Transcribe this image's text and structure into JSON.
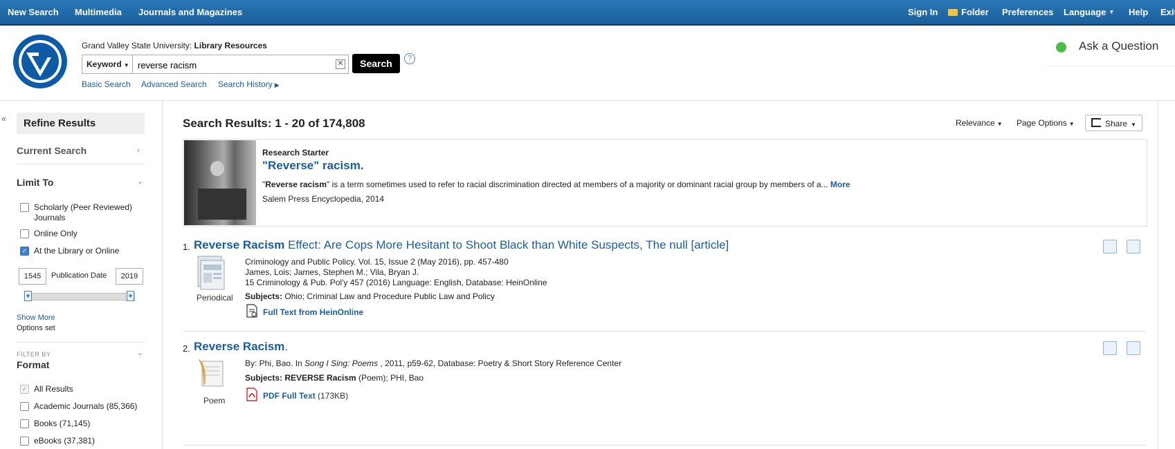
{
  "topbar": {
    "new_search": "New Search",
    "multimedia": "Multimedia",
    "journals": "Journals and Magazines",
    "sign_in": "Sign In",
    "folder": "Folder",
    "preferences": "Preferences",
    "language": "Language",
    "help": "Help",
    "exit": "Exit"
  },
  "header": {
    "institution": "Grand Valley State University:",
    "resources": "Library Resources",
    "field_select": "Keyword",
    "query": "reverse racism",
    "search_button": "Search",
    "help_glyph": "?",
    "links": {
      "basic": "Basic Search",
      "advanced": "Advanced Search",
      "history": "Search History"
    },
    "ask": "Ask a Question"
  },
  "sidebar": {
    "refine": "Refine Results",
    "current_search": "Current Search",
    "limit_to": "Limit To",
    "limits": [
      {
        "label_line1": "Scholarly (Peer Reviewed)",
        "label_line2": "Journals",
        "checked": false
      },
      {
        "label": "Online Only",
        "checked": false
      },
      {
        "label": "At the Library or Online",
        "checked": true
      }
    ],
    "pub_date": {
      "from": "1545",
      "to": "2019",
      "label": "Publication Date"
    },
    "show_more": "Show More",
    "options_set": "Options set",
    "filter_by": "FILTER BY",
    "format": "Format",
    "formats": [
      {
        "label": "All Results",
        "checked": true
      },
      {
        "label": "Academic Journals (85,366)",
        "checked": false
      },
      {
        "label": "Books (71,145)",
        "checked": false
      },
      {
        "label": "eBooks (37,381)",
        "checked": false
      }
    ]
  },
  "results": {
    "header": "Search Results: 1 - 20 of 174,808",
    "sort": "Relevance",
    "page_options": "Page Options",
    "share": "Share",
    "starter": {
      "label": "Research Starter",
      "title": "\"Reverse\" racism.",
      "desc_quote_open": "\"",
      "desc_bold": "Reverse racism",
      "desc_rest": "\" is a term sometimes used to refer to racial discrimination directed at members of a majority or dominant racial group by members of a...",
      "more": "More",
      "source": "Salem Press Encyclopedia, 2014"
    },
    "items": [
      {
        "num": "1.",
        "title_bold": "Reverse Racism",
        "title_rest": " Effect: Are Cops More Hesitant to Shoot Black than White Suspects, The null [article]",
        "type": "Periodical",
        "line1": "Criminology and Public Policy, Vol. 15, Issue 2 (May 2016), pp. 457-480",
        "line2": "James, Lois; James, Stephen M.; Vila, Bryan J.",
        "line3": "15 Criminology & Pub. Pol'y 457 (2016) Language: English, Database: HeinOnline",
        "subjects_label": "Subjects:",
        "subjects": " Ohio; Criminal Law and Procedure Public Law and Policy",
        "link": "Full Text from HeinOnline"
      },
      {
        "num": "2.",
        "title_bold": "Reverse Racism",
        "title_rest": ".",
        "type": "Poem",
        "line1_pre": "By: Phi, Bao. In ",
        "line1_em": "Song I Sing: Poems",
        "line1_post": " , 2011, p59-62, Database: Poetry & Short Story Reference Center",
        "subjects_label": "Subjects:",
        "subjects_bold": " REVERSE Racism",
        "subjects_rest": " (Poem); PHI, Bao",
        "link": "PDF Full Text",
        "size": "(173KB)"
      }
    ]
  },
  "colors": {
    "topbar": "#1a5f9c",
    "link": "#1a5c9e",
    "ask_dot": "#4cbb4c"
  }
}
